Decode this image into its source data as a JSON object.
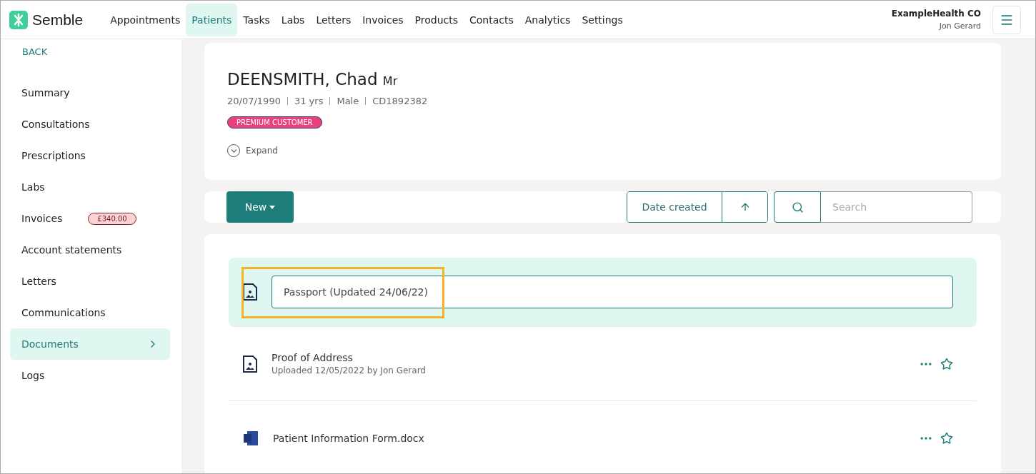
{
  "brand": {
    "name": "Semble"
  },
  "nav": [
    {
      "label": "Appointments",
      "selected": false
    },
    {
      "label": "Patients",
      "selected": true
    },
    {
      "label": "Tasks",
      "selected": false
    },
    {
      "label": "Labs",
      "selected": false
    },
    {
      "label": "Letters",
      "selected": false
    },
    {
      "label": "Invoices",
      "selected": false
    },
    {
      "label": "Products",
      "selected": false
    },
    {
      "label": "Contacts",
      "selected": false
    },
    {
      "label": "Analytics",
      "selected": false
    },
    {
      "label": "Settings",
      "selected": false
    }
  ],
  "account": {
    "organisation": "ExampleHealth CO",
    "user": "Jon Gerard"
  },
  "sidebar": {
    "back": "BACK",
    "items": [
      {
        "label": "Summary",
        "selected": false
      },
      {
        "label": "Consultations",
        "selected": false
      },
      {
        "label": "Prescriptions",
        "selected": false
      },
      {
        "label": "Labs",
        "selected": false
      },
      {
        "label": "Invoices",
        "selected": false,
        "badge": "£340.00"
      },
      {
        "label": "Account statements",
        "selected": false
      },
      {
        "label": "Letters",
        "selected": false
      },
      {
        "label": "Communications",
        "selected": false
      },
      {
        "label": "Documents",
        "selected": true
      },
      {
        "label": "Logs",
        "selected": false
      }
    ]
  },
  "patient": {
    "surname": "DEENSMITH, Chad",
    "title": "Mr",
    "details": [
      "20/07/1990",
      "31 yrs",
      "Male",
      "CD1892382"
    ],
    "tag": "PREMIUM CUSTOMER",
    "expand": "Expand"
  },
  "toolbar": {
    "new_button": "New",
    "sort": "Date created",
    "search": {
      "placeholder": "Search"
    }
  },
  "documents": [
    {
      "kind": "image",
      "editing": true,
      "value": "Passport (Updated 24/06/22)",
      "highlighted": true
    },
    {
      "kind": "image",
      "editing": false,
      "name": "Proof of Address",
      "meta": "Uploaded 12/05/2022 by Jon Gerard",
      "highlighted": false
    },
    {
      "kind": "word",
      "editing": false,
      "name": "Patient Information Form.docx",
      "highlighted": false
    }
  ]
}
